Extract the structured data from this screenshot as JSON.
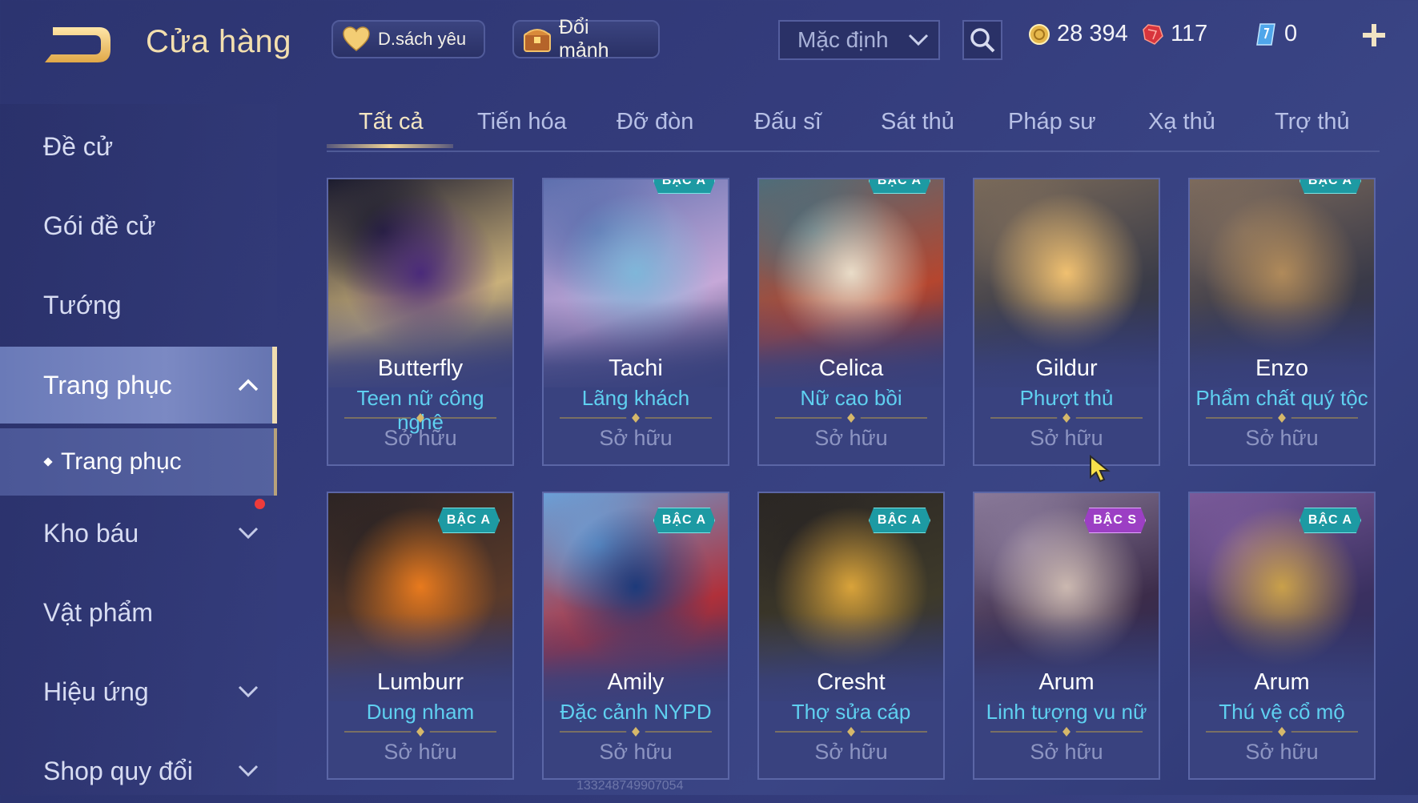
{
  "header": {
    "title": "Cửa hàng",
    "favorites_label": "D.sách yêu",
    "fragments_label": "Đổi mảnh",
    "sort_value": "Mặc định",
    "currencies": {
      "gold": "28 394",
      "ruby": "117",
      "gem": "0"
    }
  },
  "sidebar": {
    "items": [
      {
        "label": "Đề cử"
      },
      {
        "label": "Gói đề cử"
      },
      {
        "label": "Tướng"
      },
      {
        "label": "Trang phục"
      },
      {
        "label": "Kho báu"
      },
      {
        "label": "Vật phẩm"
      },
      {
        "label": "Hiệu ứng"
      },
      {
        "label": "Shop quy đổi"
      }
    ],
    "sub_item": "Trang phục"
  },
  "tabs": [
    "Tất cả",
    "Tiến hóa",
    "Đỡ đòn",
    "Đấu sĩ",
    "Sát thủ",
    "Pháp sư",
    "Xạ thủ",
    "Trợ thủ"
  ],
  "cards": [
    {
      "hero": "Butterfly",
      "skin": "Teen nữ công nghệ",
      "status": "Sở hữu",
      "tier": "",
      "colors": [
        "#4a2a7a",
        "#c9b07a",
        "#1b1b2f"
      ]
    },
    {
      "hero": "Tachi",
      "skin": "Lãng khách",
      "status": "Sở hữu",
      "tier": "BẬC A",
      "colors": [
        "#7fb6d9",
        "#c6a8d8",
        "#5d6fae"
      ]
    },
    {
      "hero": "Celica",
      "skin": "Nữ cao bồi",
      "status": "Sở hữu",
      "tier": "BẬC A",
      "colors": [
        "#e9dcc8",
        "#b5462f",
        "#4e6d7a"
      ]
    },
    {
      "hero": "Gildur",
      "skin": "Phượt thủ",
      "status": "Sở hữu",
      "tier": "",
      "colors": [
        "#f0c070",
        "#3b3c48",
        "#7a6a5a"
      ]
    },
    {
      "hero": "Enzo",
      "skin": "Phẩm chất quý tộc",
      "status": "Sở hữu",
      "tier": "BẬC A",
      "colors": [
        "#b08a5a",
        "#3a3a48",
        "#7d6b5d"
      ]
    },
    {
      "hero": "Lumburr",
      "skin": "Dung nham",
      "status": "Sở hữu",
      "tier": "BẬC A",
      "colors": [
        "#e87a1e",
        "#5a3a2a",
        "#2c2424"
      ]
    },
    {
      "hero": "Amily",
      "skin": "Đặc cảnh NYPD",
      "status": "Sở hữu",
      "tier": "BẬC A",
      "colors": [
        "#1d3a7a",
        "#b0303a",
        "#6aa0d8"
      ]
    },
    {
      "hero": "Cresht",
      "skin": "Thợ sửa cáp",
      "status": "Sở hữu",
      "tier": "BẬC A",
      "colors": [
        "#d9a33a",
        "#3e3a2a",
        "#2a2624"
      ]
    },
    {
      "hero": "Arum",
      "skin": "Linh tượng vu nữ",
      "status": "Sở hữu",
      "tier": "BẬC S",
      "colors": [
        "#cbb8b0",
        "#3c2c4a",
        "#8a7a9a"
      ]
    },
    {
      "hero": "Arum",
      "skin": "Thú vệ cổ mộ",
      "status": "Sở hữu",
      "tier": "BẬC A",
      "colors": [
        "#c9a04a",
        "#3a3060",
        "#7a5a9a"
      ]
    }
  ],
  "watermark": "133248749907054",
  "accent": {
    "gold": "#f3dfae",
    "cyan": "#5fd0f0",
    "active_tab": "#f4e6c2"
  }
}
